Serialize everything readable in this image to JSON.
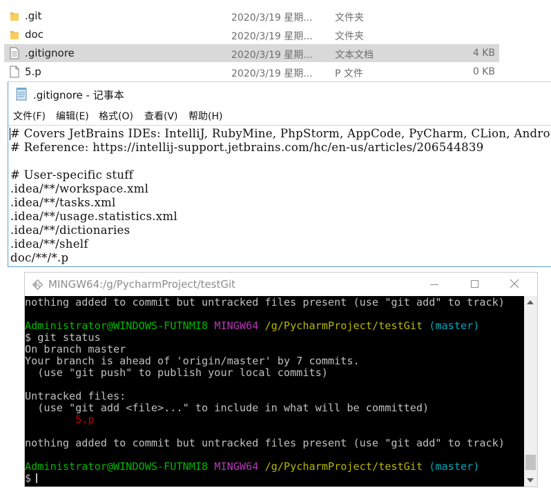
{
  "explorer": {
    "files": [
      {
        "name": ".git",
        "date": "2020/3/19 星期...",
        "type": "文件夹",
        "size": "",
        "icon": "folder-icon"
      },
      {
        "name": "doc",
        "date": "2020/3/19 星期...",
        "type": "文件夹",
        "size": "",
        "icon": "folder-icon"
      },
      {
        "name": ".gitignore",
        "date": "2020/3/19 星期...",
        "type": "文本文档",
        "size": "4 KB",
        "icon": "text-file-icon"
      },
      {
        "name": "5.p",
        "date": "2020/3/19 星期...",
        "type": "P 文件",
        "size": "0 KB",
        "icon": "blank-file-icon"
      }
    ],
    "selected_index": 2
  },
  "notepad": {
    "title": ".gitignore - 记事本",
    "menu": [
      "文件(F)",
      "编辑(E)",
      "格式(O)",
      "查看(V)",
      "帮助(H)"
    ],
    "lines": [
      "# Covers JetBrains IDEs: IntelliJ, RubyMine, PhpStorm, AppCode, PyCharm, CLion, Andro",
      "# Reference: https://intellij-support.jetbrains.com/hc/en-us/articles/206544839",
      "",
      "# User-specific stuff",
      ".idea/**/workspace.xml",
      ".idea/**/tasks.xml",
      ".idea/**/usage.statistics.xml",
      ".idea/**/dictionaries",
      ".idea/**/shelf",
      "doc/**/*.p"
    ]
  },
  "terminal": {
    "title": "MINGW64:/g/PycharmProject/testGit",
    "prompt": {
      "user": "Administrator@WINDOWS-FUTNMI8",
      "env": "MINGW64",
      "path": "/g/PycharmProject/testGit",
      "branch": "(master)",
      "symbol": "$"
    },
    "lines": [
      "nothing added to commit but untracked files present (use \"git add\" to track)",
      "",
      "__PROMPT__",
      "$ git status",
      "On branch master",
      "Your branch is ahead of 'origin/master' by 7 commits.",
      "  (use \"git push\" to publish your local commits)",
      "",
      "Untracked files:",
      "  (use \"git add <file>...\" to include in what will be committed)",
      "__UNTRACKED__",
      "",
      "nothing added to commit but untracked files present (use \"git add\" to track)",
      "",
      "__PROMPT__",
      "__CURSOR__"
    ],
    "untracked_file": "5.p",
    "colors": {
      "background": "#000000",
      "text": "#c0c0c0",
      "user": "#00b800",
      "env": "#b838b8",
      "path": "#b8b800",
      "branch": "#00a8b8",
      "untracked": "#c00000"
    }
  }
}
